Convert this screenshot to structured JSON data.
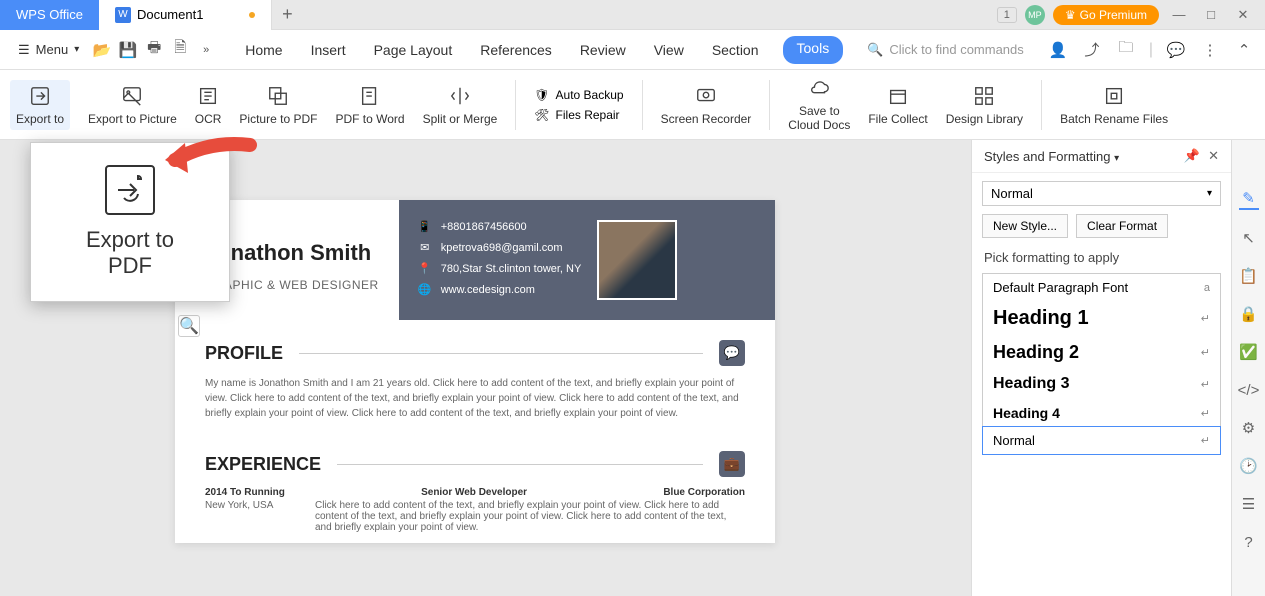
{
  "titlebar": {
    "wps_tab": "WPS Office",
    "doc_tab": "Document1",
    "badge": "1",
    "avatar": "MP",
    "premium": "Go Premium"
  },
  "menubar": {
    "menu_label": "Menu",
    "tabs": [
      "Home",
      "Insert",
      "Page Layout",
      "References",
      "Review",
      "View",
      "Section",
      "Tools"
    ],
    "search_placeholder": "Click to find commands"
  },
  "ribbon": {
    "export_to": "Export to",
    "export_picture": "Export to Picture",
    "ocr": "OCR",
    "picture_to_pdf": "Picture to PDF",
    "pdf_to_word": "PDF to Word",
    "split_merge": "Split or Merge",
    "auto_backup": "Auto Backup",
    "files_repair": "Files Repair",
    "screen_recorder": "Screen Recorder",
    "save_cloud_l1": "Save to",
    "save_cloud_l2": "Cloud Docs",
    "file_collect": "File Collect",
    "design_library": "Design Library",
    "batch_rename": "Batch Rename Files"
  },
  "callout": {
    "text_l1": "Export to",
    "text_l2": "PDF"
  },
  "resume": {
    "name": "Jonathon Smith",
    "role": "GRAPHIC & WEB DESIGNER",
    "phone": "+8801867456600",
    "email": "kpetrova698@gamil.com",
    "address": "780,Star St.clinton tower, NY",
    "website": "www.cedesign.com",
    "profile_title": "PROFILE",
    "profile_body": "My name is Jonathon Smith and I am 21 years old. Click here to add content of the text, and briefly explain your point of view. Click here to add content of the text, and briefly explain your point of view. Click here to add content of the text, and briefly explain your point of view. Click here to add content of the text, and briefly explain your point of view.",
    "experience_title": "EXPERIENCE",
    "exp_date": "2014 To Running",
    "exp_role": "Senior Web Developer",
    "exp_company": "Blue Corporation",
    "exp_loc": "New York, USA",
    "exp_body": "Click here to add content of the text, and briefly explain your point of view. Click here to add content of the text, and briefly explain your point of view. Click here to add content of the text, and briefly explain your point of view."
  },
  "styles": {
    "title": "Styles and Formatting",
    "current": "Normal",
    "new_style": "New Style...",
    "clear_format": "Clear Format",
    "pick_label": "Pick formatting to apply",
    "items": [
      "Default Paragraph Font",
      "Heading 1",
      "Heading 2",
      "Heading 3",
      "Heading 4",
      "Normal"
    ],
    "marks": [
      "a",
      "↵",
      "↵",
      "↵",
      "↵",
      "↵"
    ]
  }
}
